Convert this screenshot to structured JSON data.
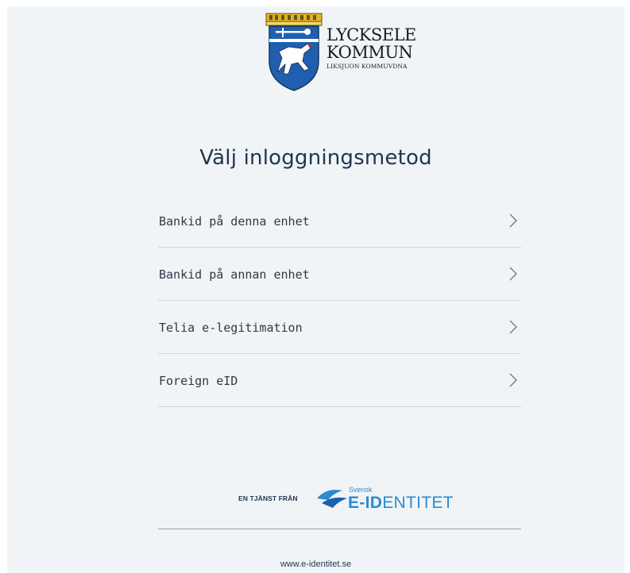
{
  "logo": {
    "line1": "LYCKSELE",
    "line2": "KOMMUN",
    "line3": "LIKSJUON KOMMUVDNA"
  },
  "title": "Välj inloggningsmetod",
  "menu": {
    "items": [
      {
        "label": "Bankid på denna enhet"
      },
      {
        "label": "Bankid på annan enhet"
      },
      {
        "label": "Telia e-legitimation"
      },
      {
        "label": "Foreign eID"
      }
    ]
  },
  "provider": {
    "prefix": "EN TJÄNST FRÅN",
    "brand_small": "Svensk",
    "brand_bold": "E-ID",
    "brand_regular": "ENTITET"
  },
  "footer": {
    "link": "www.e-identitet.se"
  },
  "colors": {
    "background": "#f1f4f7",
    "title": "#1f3550",
    "brand_blue": "#2a8bd1",
    "shield_blue": "#1f5fae",
    "crown_gold": "#e0b427"
  }
}
